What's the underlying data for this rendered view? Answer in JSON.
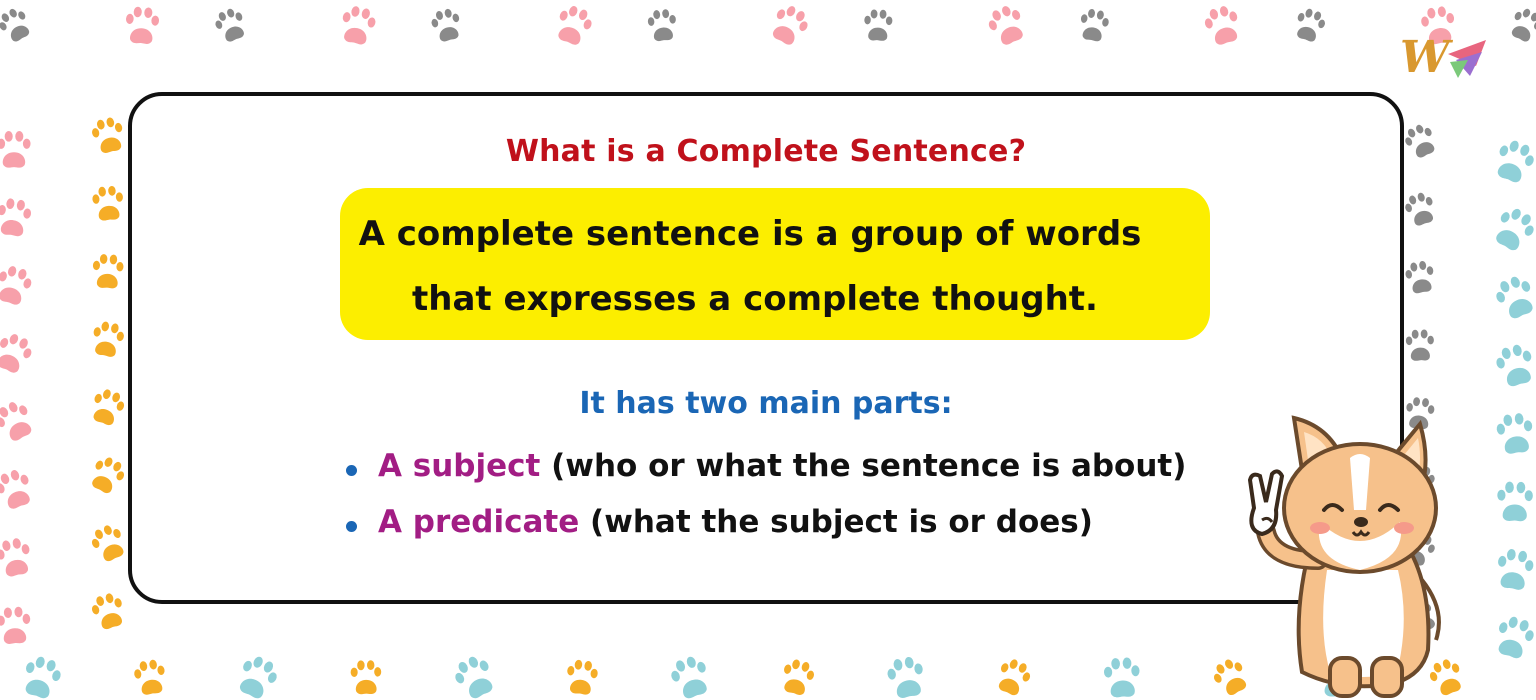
{
  "colors": {
    "title": "#c0111b",
    "highlight": "#fcee00",
    "parts_heading": "#1a66b5",
    "term": "#a21d84",
    "bullet": "#1a66b5",
    "paw_colors": [
      "#8a8a8a",
      "#8fd0d8",
      "#f7a0aa",
      "#f5ad27"
    ]
  },
  "title": "What is a Complete Sentence?",
  "definition": {
    "line1": "A complete sentence is a group of words",
    "line2": "that expresses a complete thought."
  },
  "parts_heading": "It has two main parts:",
  "parts": [
    {
      "term": "A subject",
      "description": "(who or what the sentence is about)"
    },
    {
      "term": "A predicate",
      "description": "(what the subject is or does)"
    }
  ],
  "logo": {
    "letter": "W"
  },
  "icons": {
    "background_pattern": "paw-print-icon",
    "mascot": "corgi-peace-sign-icon"
  }
}
